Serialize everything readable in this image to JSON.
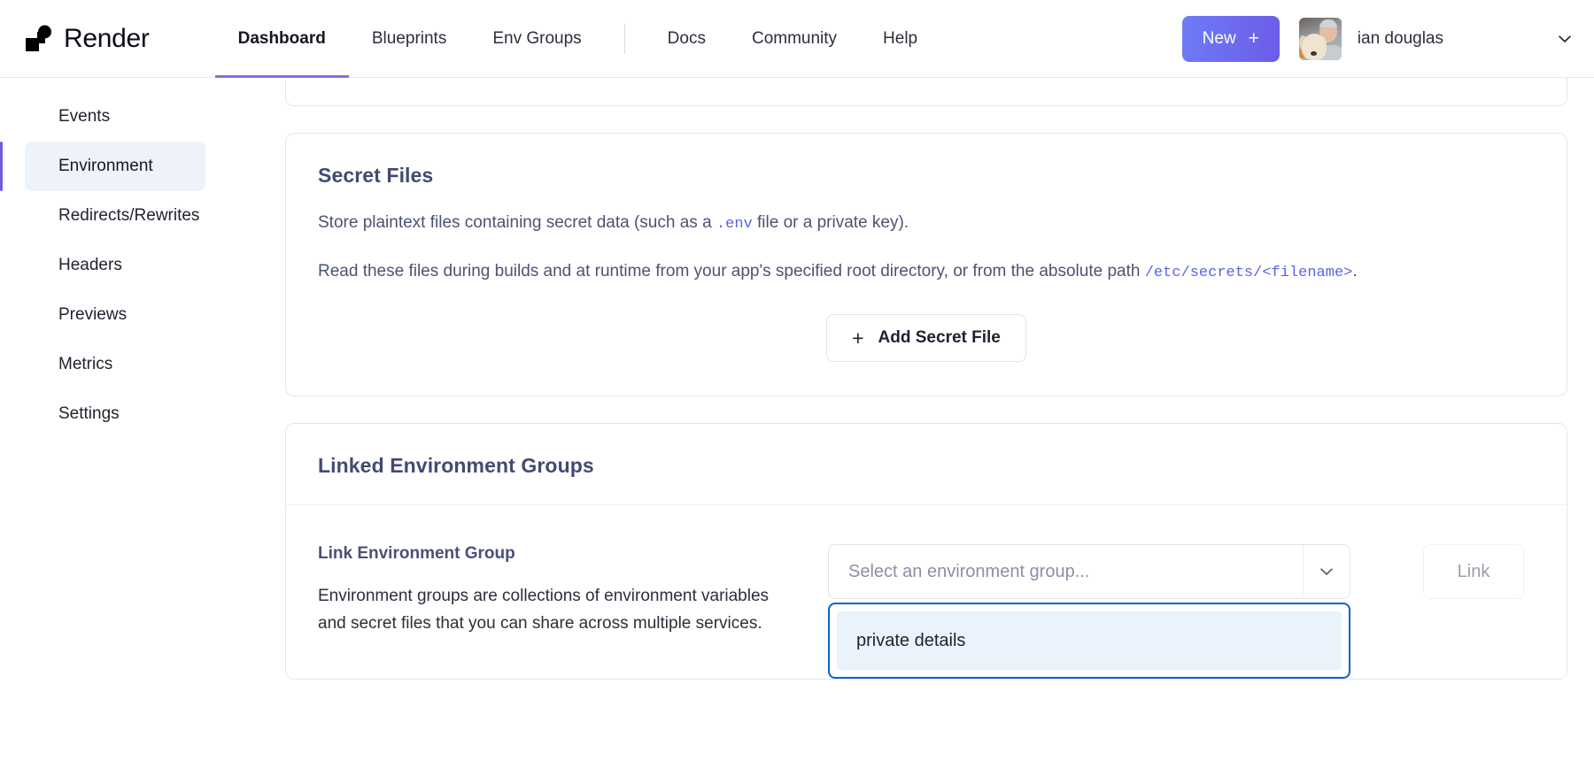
{
  "header": {
    "brand": "Render",
    "primary_nav": [
      {
        "label": "Dashboard",
        "active": true
      },
      {
        "label": "Blueprints",
        "active": false
      },
      {
        "label": "Env Groups",
        "active": false
      }
    ],
    "secondary_nav": [
      {
        "label": "Docs"
      },
      {
        "label": "Community"
      },
      {
        "label": "Help"
      }
    ],
    "new_button": "New",
    "new_button_plus": "+",
    "username": "ian douglas",
    "accent_color": "#6b5ce7",
    "active_tab_underline_color": "#7c73e6"
  },
  "sidebar": {
    "items": [
      {
        "label": "Events",
        "active": false
      },
      {
        "label": "Environment",
        "active": true
      },
      {
        "label": "Redirects/Rewrites",
        "active": false
      },
      {
        "label": "Headers",
        "active": false
      },
      {
        "label": "Previews",
        "active": false
      },
      {
        "label": "Metrics",
        "active": false
      },
      {
        "label": "Settings",
        "active": false
      }
    ],
    "active_indicator_color": "#6d5ee0",
    "active_background_color": "#eef2fb"
  },
  "secret_files": {
    "title": "Secret Files",
    "para1_before": "Store plaintext files containing secret data (such as a ",
    "para1_code": ".env",
    "para1_after": " file or a private key).",
    "para2_before": "Read these files during builds and at runtime from your app's specified root directory, or from the absolute path ",
    "para2_code": "/etc/secrets/<filename>",
    "para2_after": ".",
    "add_button_plus": "+",
    "add_button_label": "Add Secret File"
  },
  "linked_environment_groups": {
    "title": "Linked Environment Groups",
    "field_label": "Link Environment Group",
    "field_description": "Environment groups are collections of environment variables and secret files that you can share across multiple services.",
    "select": {
      "placeholder": "Select an environment group...",
      "value": "",
      "expanded": true,
      "chevron_icon": "chevron-down-icon",
      "options": [
        {
          "label": "private details",
          "highlighted": true
        }
      ],
      "focus_border_color": "#0b63c5",
      "highlight_background_color": "#eaf2fb"
    },
    "link_button": {
      "label": "Link",
      "disabled": true
    }
  }
}
